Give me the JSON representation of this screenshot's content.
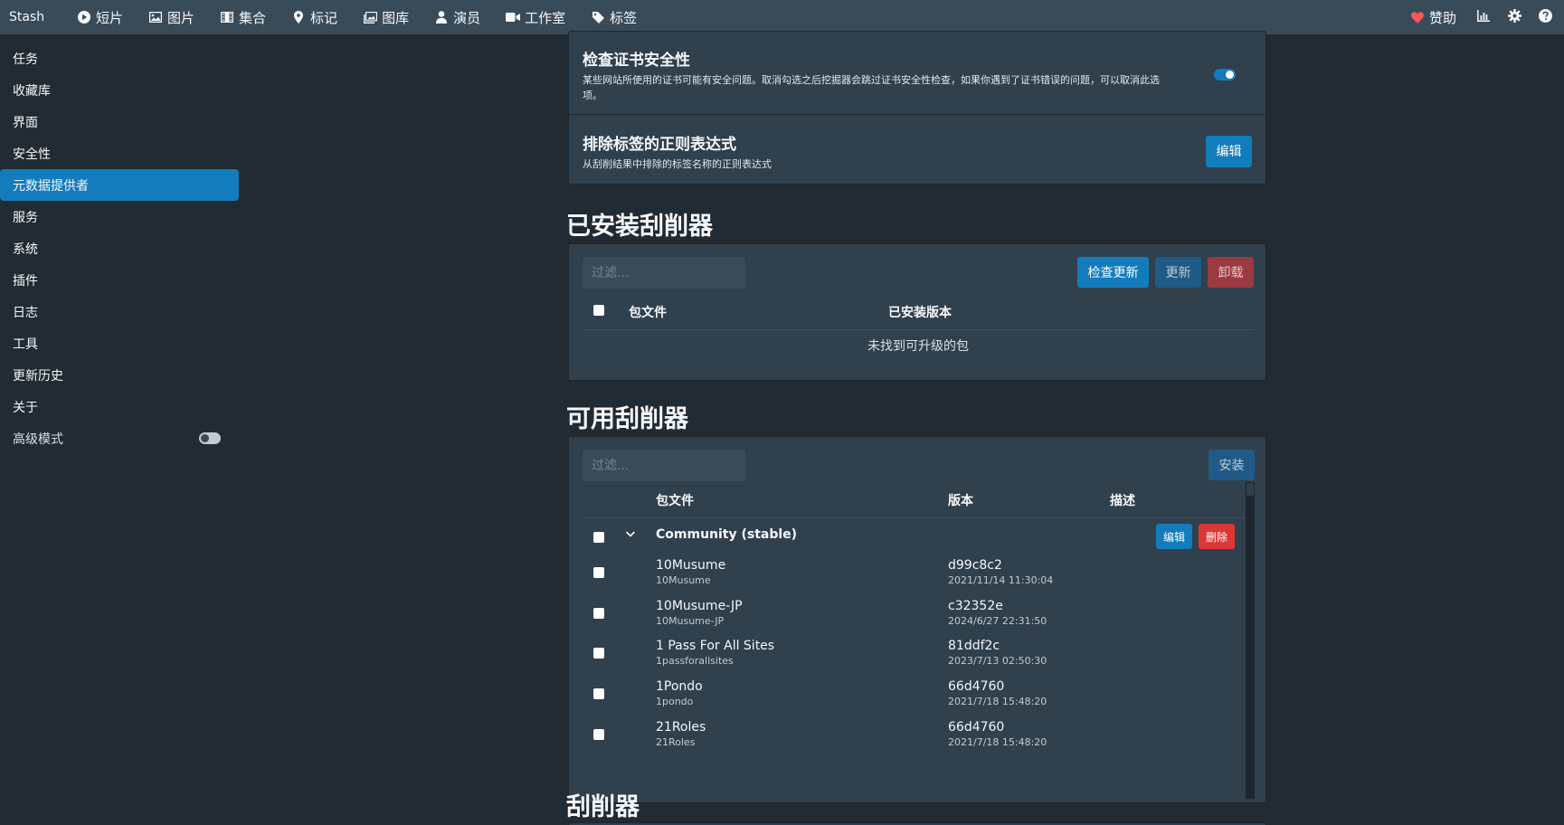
{
  "navbar": {
    "brand": "Stash",
    "items": [
      {
        "label": "短片",
        "icon": "play-circle-icon"
      },
      {
        "label": "图片",
        "icon": "image-icon"
      },
      {
        "label": "集合",
        "icon": "film-icon"
      },
      {
        "label": "标记",
        "icon": "map-marker-icon"
      },
      {
        "label": "图库",
        "icon": "images-icon"
      },
      {
        "label": "演员",
        "icon": "user-icon"
      },
      {
        "label": "工作室",
        "icon": "video-camera-icon"
      },
      {
        "label": "标签",
        "icon": "tag-icon"
      }
    ],
    "donate_label": "赞助"
  },
  "sidebar": {
    "items": [
      {
        "label": "任务"
      },
      {
        "label": "收藏库"
      },
      {
        "label": "界面"
      },
      {
        "label": "安全性"
      },
      {
        "label": "元数据提供者",
        "active": true
      },
      {
        "label": "服务"
      },
      {
        "label": "系统"
      },
      {
        "label": "插件"
      },
      {
        "label": "日志"
      },
      {
        "label": "工具"
      },
      {
        "label": "更新历史"
      },
      {
        "label": "关于"
      }
    ],
    "advanced_mode_label": "高级模式",
    "advanced_mode_on": false
  },
  "settings": {
    "cert_check": {
      "title": "检查证书安全性",
      "description": "某些网站所使用的证书可能有安全问题。取消勾选之后挖掘器会跳过证书安全性检查，如果你遇到了证书错误的问题，可以取消此选项。",
      "enabled": true
    },
    "exclude_tags": {
      "title": "排除标签的正则表达式",
      "description": "从刮削结果中排除的标签名称的正则表达式",
      "edit_label": "编辑"
    }
  },
  "installed": {
    "title": "已安装刮削器",
    "filter_placeholder": "过滤...",
    "check_updates_label": "检查更新",
    "update_label": "更新",
    "uninstall_label": "卸载",
    "col_package": "包文件",
    "col_installed_version": "已安装版本",
    "empty_text": "未找到可升级的包"
  },
  "available": {
    "title": "可用刮削器",
    "filter_placeholder": "过滤...",
    "install_label": "安装",
    "col_package": "包文件",
    "col_version": "版本",
    "col_description": "描述",
    "source": {
      "name": "Community (stable)",
      "edit_label": "编辑",
      "delete_label": "删除"
    },
    "packages": [
      {
        "name": "10Musume",
        "id": "10Musume",
        "version": "d99c8c2",
        "date": "2021/11/14 11:30:04"
      },
      {
        "name": "10Musume-JP",
        "id": "10Musume-JP",
        "version": "c32352e",
        "date": "2024/6/27 22:31:50"
      },
      {
        "name": "1 Pass For All Sites",
        "id": "1passforallsites",
        "version": "81ddf2c",
        "date": "2023/7/13 02:50:30"
      },
      {
        "name": "1Pondo",
        "id": "1pondo",
        "version": "66d4760",
        "date": "2021/7/18 15:48:20"
      },
      {
        "name": "21Roles",
        "id": "21Roles",
        "version": "66d4760",
        "date": "2021/7/18 15:48:20"
      }
    ]
  },
  "scrapers": {
    "title": "刮削器"
  },
  "colors": {
    "navbar_bg": "#394b59",
    "page_bg": "#202b33",
    "card_bg": "#30404d",
    "primary": "#137cbd",
    "danger": "#db3737",
    "heart": "#f55656"
  }
}
